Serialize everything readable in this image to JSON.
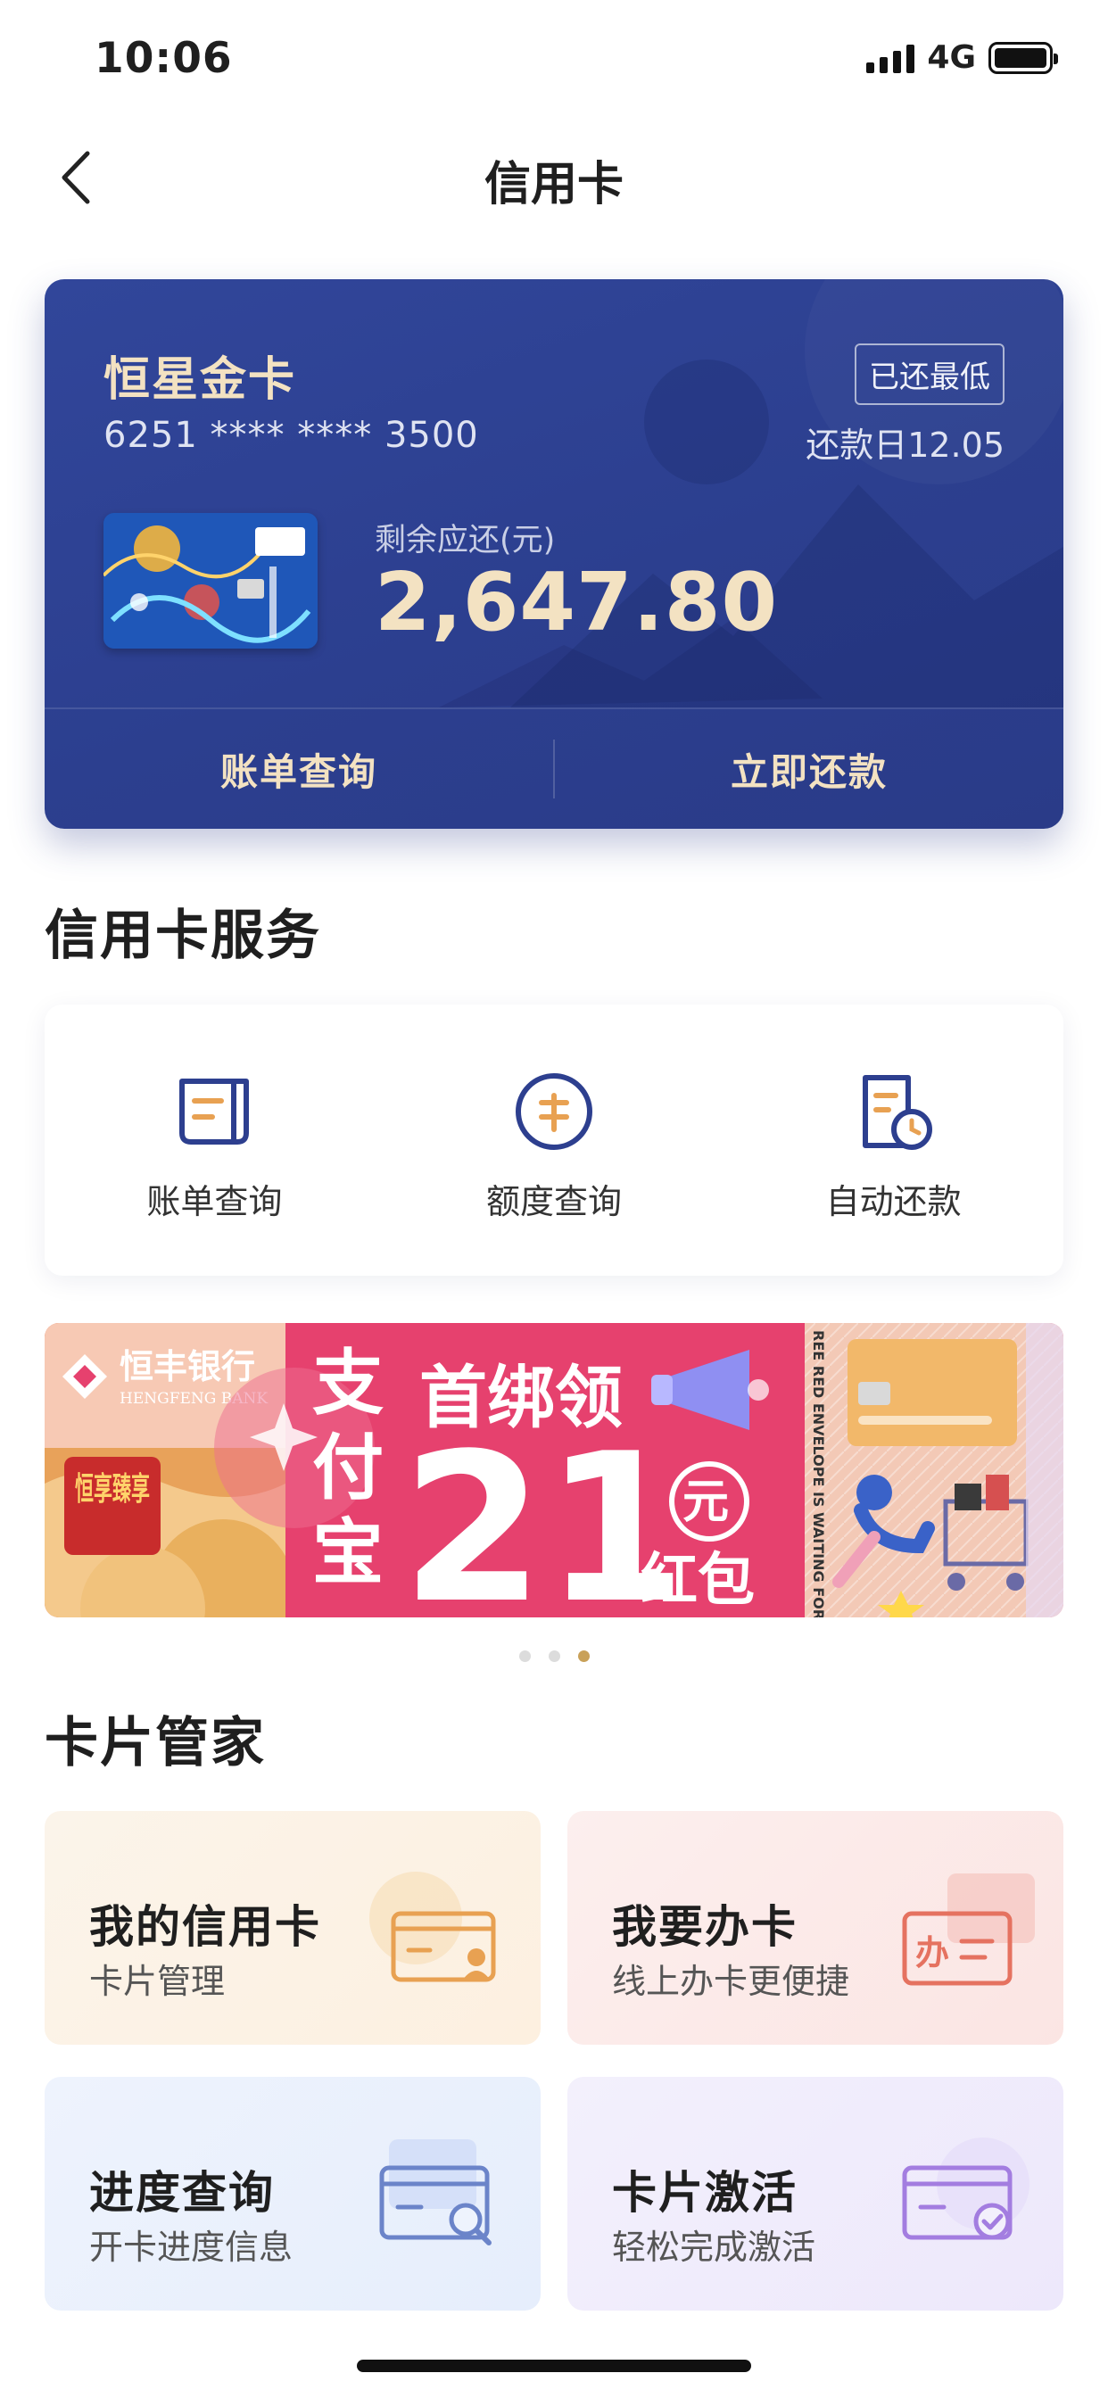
{
  "status_bar": {
    "time": "10:06",
    "network": "4G"
  },
  "nav": {
    "title": "信用卡"
  },
  "credit_card": {
    "name": "恒星金卡",
    "number": "6251 **** **** 3500",
    "repay_status": "已还最低",
    "due_date": "还款日12.05",
    "remaining_label": "剩余应还(元)",
    "remaining_amount": "2,647.80",
    "actions": [
      "账单查询",
      "立即还款"
    ]
  },
  "services": {
    "title": "信用卡服务",
    "items": [
      {
        "label": "账单查询",
        "icon": "bill-icon"
      },
      {
        "label": "额度查询",
        "icon": "credit-limit-icon"
      },
      {
        "label": "自动还款",
        "icon": "auto-repay-icon"
      }
    ]
  },
  "banner": {
    "bank_name": "恒丰银行",
    "bank_name_en": "HENGFENG BANK",
    "tag": "恒享臻享",
    "headline_left": "支付宝",
    "headline_top": "首绑领",
    "amount": "21",
    "unit": "元",
    "suffix": "红包",
    "vertical_text": "REE RED ENVELOPE IS WAITING FOR YOU",
    "active_index": 2,
    "total": 3
  },
  "card_butler": {
    "title": "卡片管家",
    "items": [
      {
        "title": "我的信用卡",
        "subtitle": "卡片管理",
        "icon": "card-user-icon"
      },
      {
        "title": "我要办卡",
        "subtitle": "线上办卡更便捷",
        "icon": "card-apply-icon"
      },
      {
        "title": "进度查询",
        "subtitle": "开卡进度信息",
        "icon": "card-search-icon"
      },
      {
        "title": "卡片激活",
        "subtitle": "轻松完成激活",
        "icon": "card-activate-icon"
      }
    ]
  },
  "colors": {
    "card_blue": "#2c3f8f",
    "gold_text": "#f3e2c2",
    "icon_blue": "#2d3f8f",
    "icon_orange": "#e8a152",
    "banner_pink": "#e6416e"
  }
}
